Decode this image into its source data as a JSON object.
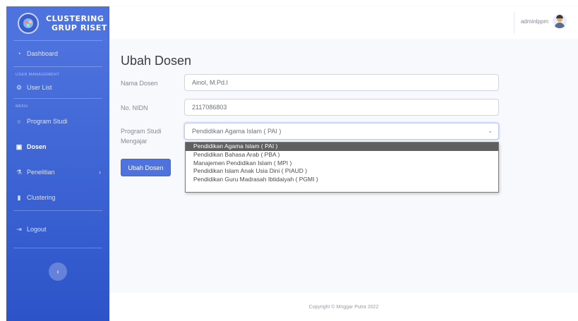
{
  "sidebar": {
    "brand_line1": "CLUSTERING",
    "brand_line2": "GRUP RISET",
    "items": [
      {
        "label": "Dashboard",
        "icon": "dashboard-icon"
      },
      {
        "label": "User List",
        "icon": "user-icon"
      },
      {
        "label": "Program Studi",
        "icon": "circle-icon"
      },
      {
        "label": "Dosen",
        "icon": "id-card-icon"
      },
      {
        "label": "Penelitian",
        "icon": "research-icon"
      },
      {
        "label": "Clustering",
        "icon": "chart-icon"
      },
      {
        "label": "Logout",
        "icon": "logout-icon"
      }
    ],
    "heading_user": "USER MANAGEMENT",
    "heading_menu": "MENU"
  },
  "topbar": {
    "username": "adminlppm"
  },
  "page": {
    "title": "Ubah Dosen"
  },
  "form": {
    "nama_label": "Nama Dosen",
    "nama_value": "Ainol, M.Pd.I",
    "nidn_label": "No. NIDN",
    "nidn_value": "2117086803",
    "prodi_label_1": "Program Studi",
    "prodi_label_2": "Mengajar",
    "prodi_selected": "Pendidikan Agama Islam ( PAI )",
    "submit_label": "Ubah Dosen"
  },
  "dropdown": {
    "options": [
      "Pendidikan Agama Islam ( PAI )",
      "Pendidikan Bahasa Arab ( PBA )",
      "Manajemen Pendidikan Islam ( MPI )",
      "Pendidikan Islam Anak Usia Dini ( PIAUD )",
      "Pendidikan Guru Madrasah Ibtidaiyah ( PGMI )"
    ]
  },
  "footer": {
    "text": "Copyright © Mnggar Putra 2022"
  },
  "colors": {
    "primary": "#4e73df",
    "sidebar_dark": "#2c54c8"
  }
}
